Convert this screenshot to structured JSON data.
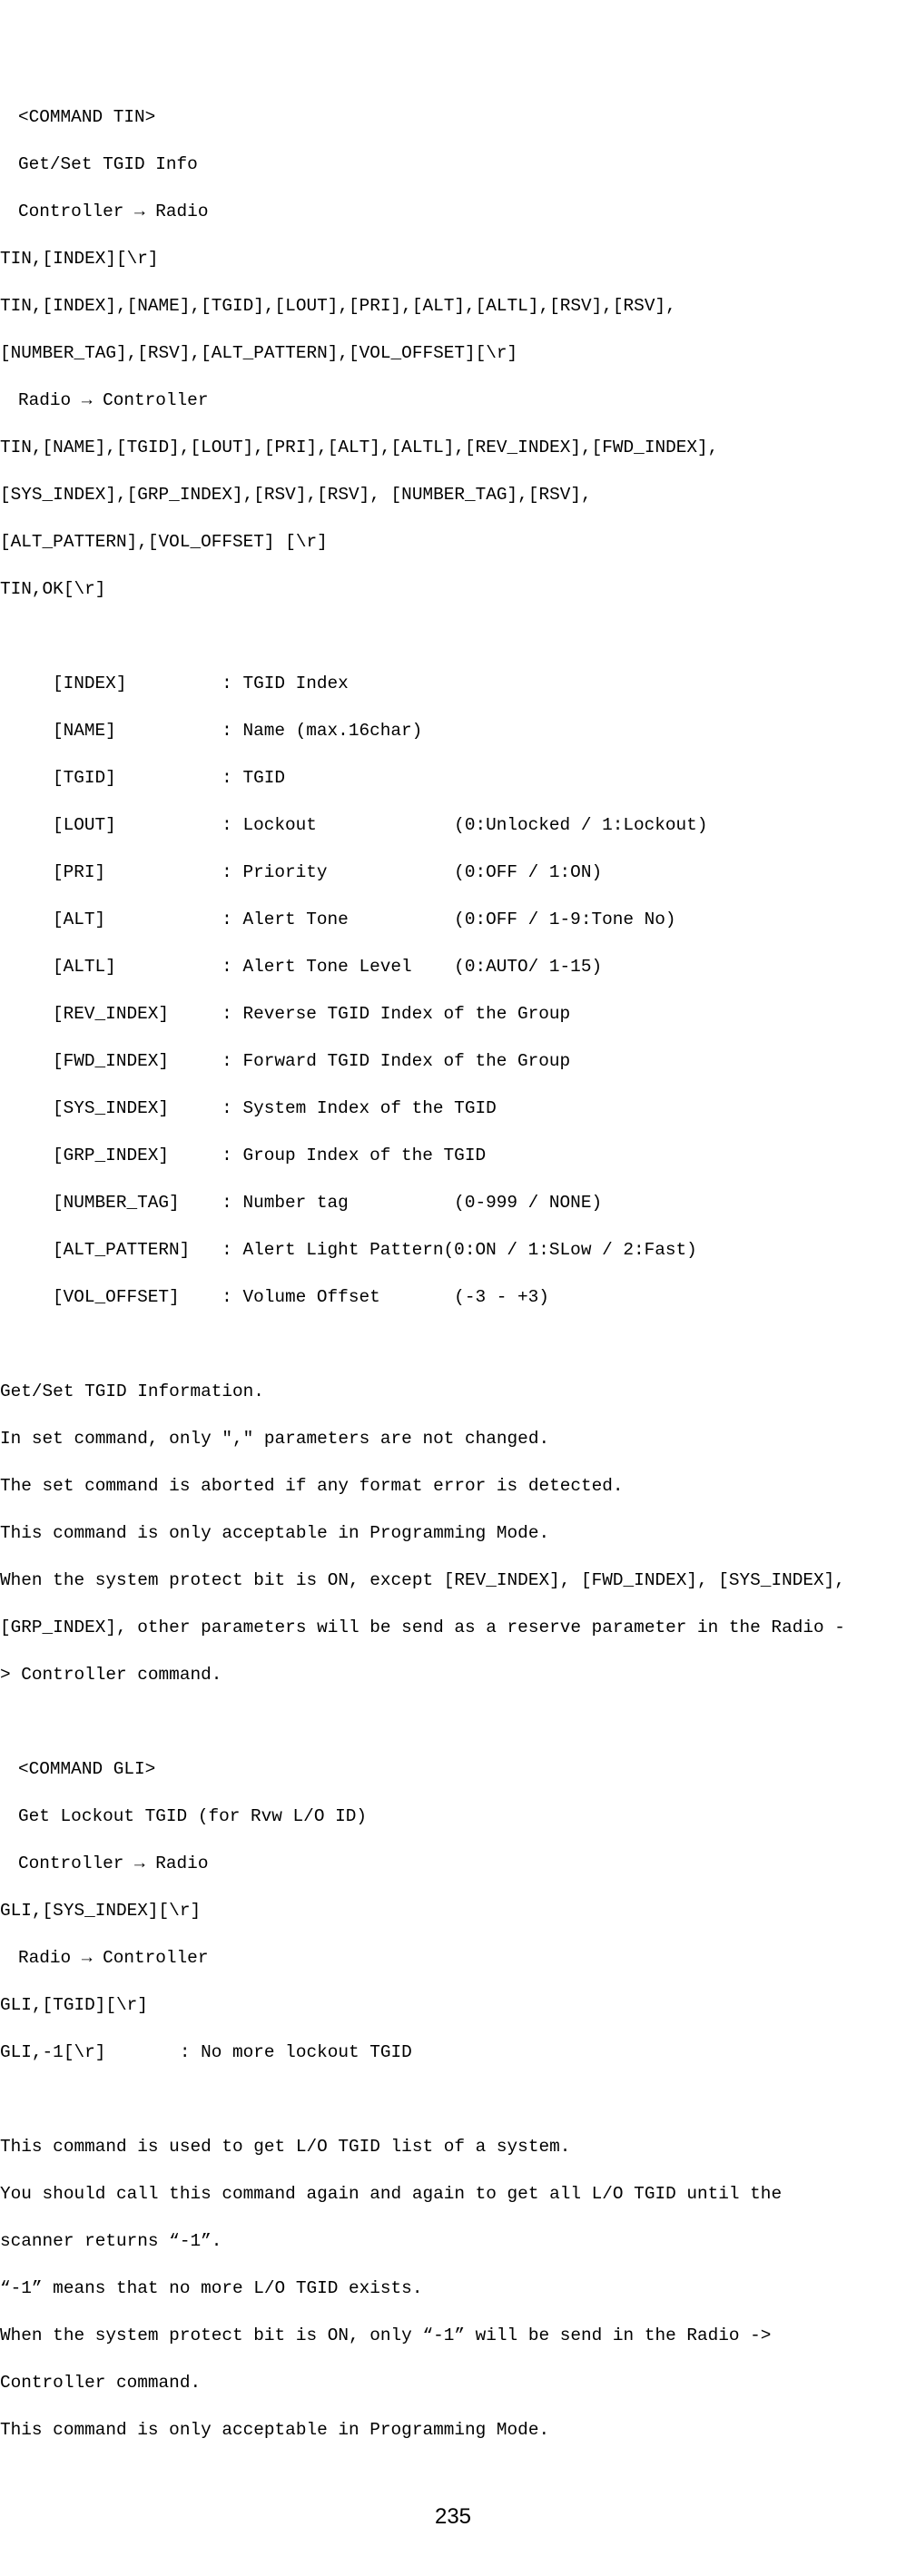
{
  "tin": {
    "header": "<COMMAND TIN>",
    "title": "Get/Set TGID Info",
    "ctr": "Controller → Radio",
    "cr1": "TIN,[INDEX][\\r]",
    "cr2": "TIN,[INDEX],[NAME],[TGID],[LOUT],[PRI],[ALT],[ALTL],[RSV],[RSV],",
    "cr3": "[NUMBER_TAG],[RSV],[ALT_PATTERN],[VOL_OFFSET][\\r]",
    "rtc": "Radio → Controller",
    "rc1": "TIN,[NAME],[TGID],[LOUT],[PRI],[ALT],[ALTL],[REV_INDEX],[FWD_INDEX],",
    "rc2": "[SYS_INDEX],[GRP_INDEX],[RSV],[RSV], [NUMBER_TAG],[RSV],",
    "rc3": "[ALT_PATTERN],[VOL_OFFSET] [\\r]",
    "rc4": "TIN,OK[\\r]",
    "p": [
      "[INDEX]         : TGID Index",
      "[NAME]          : Name (max.16char)",
      "[TGID]          : TGID",
      "[LOUT]          : Lockout             (0:Unlocked / 1:Lockout)",
      "[PRI]           : Priority            (0:OFF / 1:ON)",
      "[ALT]           : Alert Tone          (0:OFF / 1-9:Tone No)",
      "[ALTL]          : Alert Tone Level    (0:AUTO/ 1-15)",
      "[REV_INDEX]     : Reverse TGID Index of the Group",
      "[FWD_INDEX]     : Forward TGID Index of the Group",
      "[SYS_INDEX]     : System Index of the TGID",
      "[GRP_INDEX]     : Group Index of the TGID",
      "[NUMBER_TAG]    : Number tag          (0-999 / NONE)",
      "[ALT_PATTERN]   : Alert Light Pattern(0:ON / 1:SLow / 2:Fast)",
      "[VOL_OFFSET]    : Volume Offset       (-3 - +3)"
    ],
    "d": [
      "Get/Set TGID Information.",
      "In set command, only \",\" parameters are not changed.",
      "The set command is aborted if any format error is detected.",
      "This command is only acceptable in Programming Mode.",
      "When the system protect bit is ON, except [REV_INDEX], [FWD_INDEX], [SYS_INDEX],",
      "[GRP_INDEX], other parameters will be send as a reserve parameter in the Radio -",
      "> Controller command."
    ]
  },
  "gli": {
    "header": "<COMMAND GLI>",
    "title": "Get Lockout TGID (for Rvw L/O ID)",
    "ctr": "Controller → Radio",
    "cr1": "GLI,[SYS_INDEX][\\r]",
    "rtc": "Radio → Controller",
    "rc1": "GLI,[TGID][\\r]",
    "rc2": "GLI,-1[\\r]       : No more lockout TGID",
    "d": [
      "This command is used to get L/O TGID list of a system.",
      "You should call this command again and again to get all L/O TGID until the",
      "scanner returns “-1”.",
      "“-1” means that no more L/O TGID exists.",
      "When the system protect bit is ON, only “-1” will be send in the Radio ->",
      "Controller command.",
      "This command is only acceptable in Programming Mode."
    ]
  },
  "page_number": "235"
}
